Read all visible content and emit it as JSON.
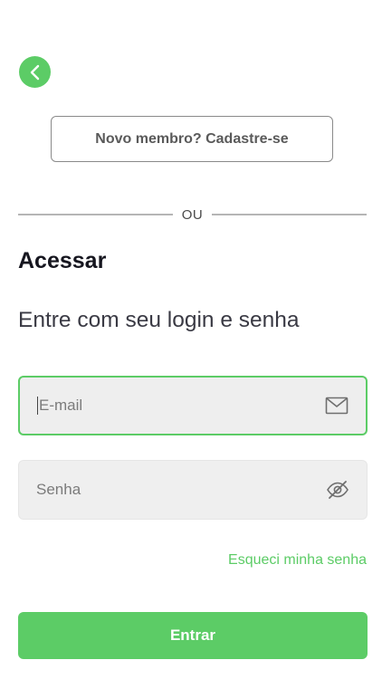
{
  "header": {
    "back_icon": "chevron-left-icon"
  },
  "signup": {
    "label": "Novo membro? Cadastre-se"
  },
  "divider": {
    "label": "OU"
  },
  "login": {
    "title": "Acessar",
    "subtitle": "Entre com seu login e senha",
    "email": {
      "placeholder": "E-mail",
      "value": "",
      "icon": "mail-icon"
    },
    "password": {
      "placeholder": "Senha",
      "value": "",
      "icon": "eye-off-icon"
    },
    "forgot_label": "Esqueci minha senha",
    "submit_label": "Entrar"
  },
  "colors": {
    "accent": "#5ccc66",
    "field_background": "#efefef",
    "text_dark": "#16161f"
  }
}
